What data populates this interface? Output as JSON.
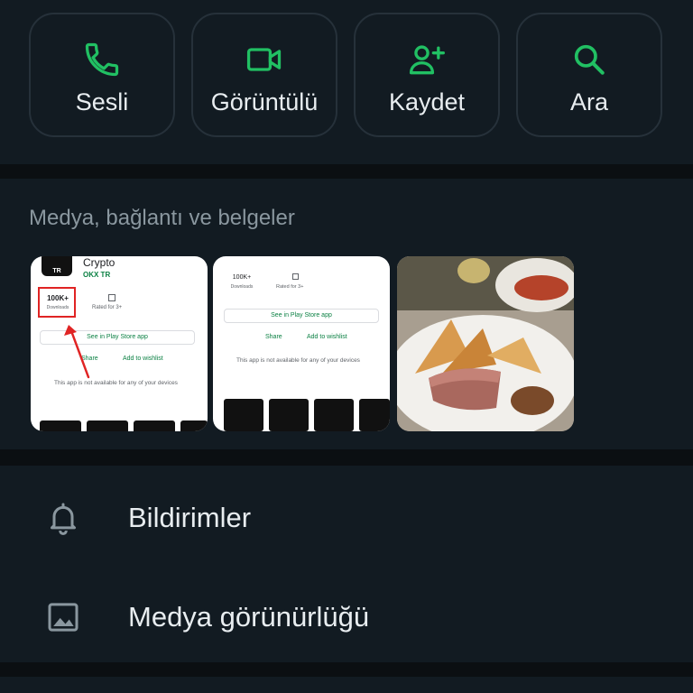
{
  "actions": [
    {
      "label": "Sesli",
      "icon": "phone-icon"
    },
    {
      "label": "Görüntülü",
      "icon": "video-camera-icon"
    },
    {
      "label": "Kaydet",
      "icon": "add-person-icon"
    },
    {
      "label": "Ara",
      "icon": "search-icon"
    }
  ],
  "media": {
    "title": "Medya, bağlantı ve belgeler",
    "thumb1": {
      "app_name": "Crypto",
      "developer": "OKX TR",
      "downloads_value": "100K+",
      "downloads_label": "Downloads",
      "rating_label": "Rated for 3+",
      "store_button": "See in Play Store app",
      "share": "Share",
      "wishlist": "Add to wishlist",
      "unavailable": "This app is not available for any of your devices",
      "logo_text": "TR"
    },
    "thumb2": {
      "downloads_value": "100K+",
      "downloads_label": "Downloads",
      "rating_label": "Rated for 3+",
      "store_button": "See in Play Store app",
      "share": "Share",
      "wishlist": "Add to wishlist",
      "unavailable": "This app is not available for any of your devices"
    }
  },
  "settings": [
    {
      "label": "Bildirimler",
      "icon": "bell-icon"
    },
    {
      "label": "Medya görünürlüğü",
      "icon": "image-icon"
    }
  ],
  "colors": {
    "accent": "#21c063",
    "panel": "#121b22",
    "background": "#0b0f12",
    "highlight_red": "#e02424"
  }
}
